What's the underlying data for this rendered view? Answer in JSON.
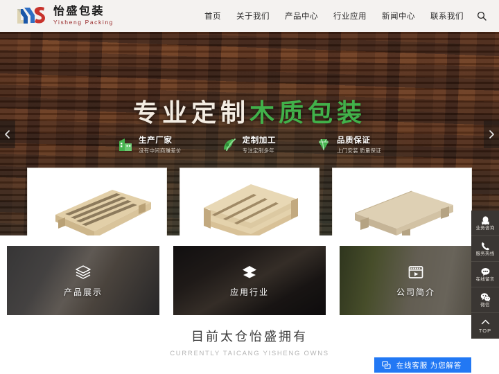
{
  "header": {
    "logo": {
      "cn": "怡盛包装",
      "en": "Yisheng Packing",
      "mark_icon": "ys-monogram-icon",
      "blue": "#1b57a8",
      "red": "#c8332c"
    },
    "nav": [
      {
        "label": "首页",
        "name": "nav-item-home"
      },
      {
        "label": "关于我们",
        "name": "nav-item-about"
      },
      {
        "label": "产品中心",
        "name": "nav-item-products"
      },
      {
        "label": "行业应用",
        "name": "nav-item-industries"
      },
      {
        "label": "新闻中心",
        "name": "nav-item-news"
      },
      {
        "label": "联系我们",
        "name": "nav-item-contact"
      }
    ],
    "search_icon": "search-icon"
  },
  "hero": {
    "title_part1": "专业定制",
    "title_part2": "木质包装",
    "title_color_1": "#f3ece2",
    "title_color_2": "#41b14a",
    "features": [
      {
        "title": "生产厂家",
        "sub": "没有中间商赚差价",
        "icon": "factory-icon"
      },
      {
        "title": "定制加工",
        "sub": "专注定制多年",
        "icon": "custom-craft-icon"
      },
      {
        "title": "品质保证",
        "sub": "上门安装 质量保证",
        "icon": "diamond-icon"
      }
    ],
    "product_images": [
      {
        "alt": "wooden-pallet-slatted",
        "name": "hero-product-1"
      },
      {
        "alt": "wooden-pallet-stacked",
        "name": "hero-product-2"
      },
      {
        "alt": "wooden-pallet-solid-deck",
        "name": "hero-product-3"
      }
    ],
    "prev_icon": "chevron-left-icon",
    "next_icon": "chevron-right-icon"
  },
  "cards": [
    {
      "label": "产品展示",
      "icon": "layers-outline-icon",
      "name": "card-products"
    },
    {
      "label": "应用行业",
      "icon": "layers-filled-icon",
      "name": "card-industries"
    },
    {
      "label": "公司简介",
      "icon": "video-play-icon",
      "name": "card-company"
    }
  ],
  "bottom": {
    "heading_cn": "目前太仓怡盛拥有",
    "heading_en": "CURRENTLY TAICANG YISHENG OWNS"
  },
  "right_rail": [
    {
      "label": "业务咨询",
      "icon": "qq-penguin-icon",
      "name": "rail-business-consult"
    },
    {
      "label": "服务热线",
      "icon": "phone-icon",
      "name": "rail-service-hotline"
    },
    {
      "label": "在线留言",
      "icon": "message-icon",
      "name": "rail-online-message"
    },
    {
      "label": "微信",
      "icon": "wechat-icon",
      "name": "rail-wechat"
    },
    {
      "label": "TOP",
      "icon": "chevron-up-icon",
      "name": "rail-back-to-top"
    }
  ],
  "chat_widget": {
    "label": "在线客服 为您解答",
    "icon": "chat-bubbles-icon",
    "color": "#2278f4"
  }
}
